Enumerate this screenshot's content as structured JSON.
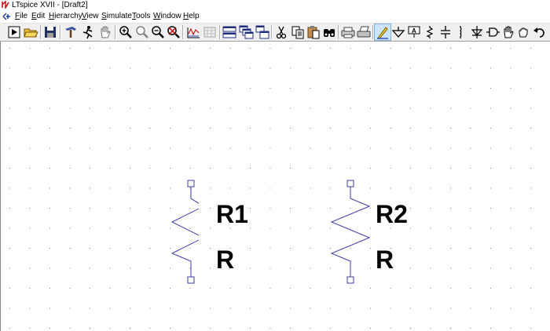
{
  "window": {
    "title": "LTspice XVII - [Draft2]"
  },
  "menu": {
    "items": [
      "File",
      "Edit",
      "Hierarchy",
      "View",
      "Simulate",
      "Tools",
      "Window",
      "Help"
    ]
  },
  "toolbar": {
    "buttons": [
      "run-icon",
      "open-icon",
      "save-icon",
      "control-panel-icon",
      "halt-icon",
      "pan-icon",
      "zoom-in-icon",
      "zoom-area-icon",
      "zoom-out-icon",
      "zoom-fit-icon",
      "autorange-icon",
      "grid-icon",
      "tile-horizontal-icon",
      "cascade-icon",
      "tile-vertical-icon",
      "cut-icon",
      "copy-icon",
      "paste-icon",
      "find-icon",
      "print-setup-icon",
      "print-icon",
      "draw-wire-icon",
      "ground-icon",
      "label-net-icon",
      "resistor-icon",
      "capacitor-icon",
      "inductor-icon",
      "diode-icon",
      "component-icon",
      "move-icon",
      "drag-icon",
      "undo-icon"
    ]
  },
  "schematic": {
    "components": [
      {
        "designator": "R1",
        "value": "R"
      },
      {
        "designator": "R2",
        "value": "R"
      }
    ],
    "wire_color": "#3c3ca8"
  }
}
